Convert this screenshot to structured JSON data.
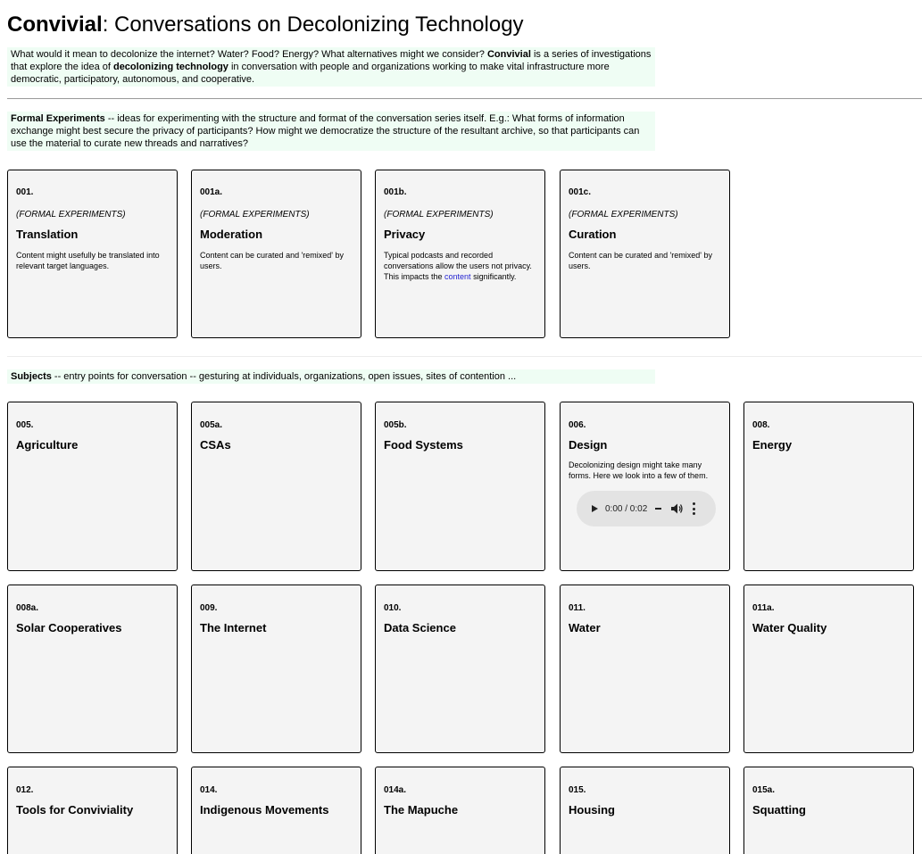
{
  "header": {
    "title_bold": "Convivial",
    "title_rest": ": Conversations on Decolonizing Technology"
  },
  "intro": {
    "part1": "What would it mean to decolonize the internet? Water? Food? Energy? What alternatives might we consider? ",
    "bold1": "Convivial",
    "part2": " is a series of investigations that explore the idea of ",
    "bold2": "decolonizing technology",
    "part3": " in conversation with people and organizations working to make vital infrastructure more democratic, participatory, autonomous, and cooperative."
  },
  "formal_section": {
    "heading": "Formal Experiments",
    "text": " -- ideas for experimenting with the structure and format of the conversation series itself. E.g.: What forms of information exchange might best secure the privacy of participants? How might we democratize the structure of the resultant archive, so that participants can use the material to curate new threads and narratives?",
    "cards": [
      {
        "num": "001.",
        "category": "(FORMAL EXPERIMENTS)",
        "title": "Translation",
        "desc": "Content might usefully be translated into relevant target languages."
      },
      {
        "num": "001a.",
        "category": "(FORMAL EXPERIMENTS)",
        "title": "Moderation",
        "desc": "Content can be curated and 'remixed' by users."
      },
      {
        "num": "001b.",
        "category": "(FORMAL EXPERIMENTS)",
        "title": "Privacy",
        "desc_before": "Typical podcasts and recorded conversations allow the users not privacy. This impacts the ",
        "desc_link": "content",
        "desc_after": " significantly."
      },
      {
        "num": "001c.",
        "category": "(FORMAL EXPERIMENTS)",
        "title": "Curation",
        "desc": "Content can be curated and 'remixed' by users."
      }
    ]
  },
  "subjects_section": {
    "heading": "Subjects",
    "text": " -- entry points for conversation -- gesturing at individuals, organizations, open issues, sites of contention ...",
    "cards": [
      {
        "num": "005.",
        "title": "Agriculture"
      },
      {
        "num": "005a.",
        "title": "CSAs"
      },
      {
        "num": "005b.",
        "title": "Food Systems"
      },
      {
        "num": "006.",
        "title": "Design",
        "desc": "Decolonizing design might take many forms. Here we look into a few of them."
      },
      {
        "num": "008.",
        "title": "Energy"
      },
      {
        "num": "008a.",
        "title": "Solar Cooperatives"
      },
      {
        "num": "009.",
        "title": "The Internet"
      },
      {
        "num": "010.",
        "title": "Data Science"
      },
      {
        "num": "011.",
        "title": "Water"
      },
      {
        "num": "011a.",
        "title": "Water Quality"
      },
      {
        "num": "012.",
        "title": "Tools for Conviviality"
      },
      {
        "num": "014.",
        "title": "Indigenous Movements"
      },
      {
        "num": "014a.",
        "title": "The Mapuche"
      },
      {
        "num": "015.",
        "title": "Housing"
      },
      {
        "num": "015a.",
        "title": "Squatting"
      }
    ]
  },
  "audio": {
    "time": "0:00 / 0:02",
    "play_icon": "play-icon",
    "volume_icon": "volume-icon",
    "more_icon": "more-options-icon"
  },
  "colors": {
    "note_background": "#effdf4",
    "card_background": "#f4f4f4",
    "link": "#1f1fd0"
  }
}
